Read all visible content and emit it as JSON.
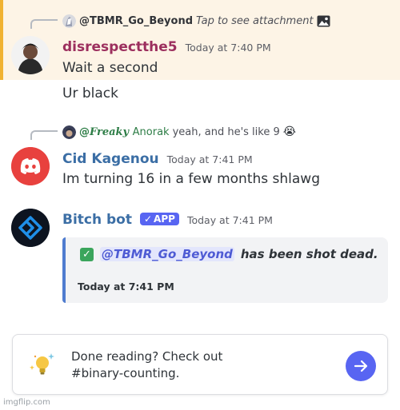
{
  "messages": [
    {
      "reply": {
        "name": "@TBMR_Go_Beyond",
        "text": "Tap to see attachment",
        "icon": "image-icon"
      },
      "author": "disrespectthe5",
      "author_color": "#9c2f5e",
      "timestamp": "Today at 7:40 PM",
      "lines": [
        "Wait a second",
        "Ur black"
      ]
    },
    {
      "reply": {
        "name_prefix": "@",
        "name_fancy": "Freaky",
        "name_rest": "Anorak",
        "text": "yeah, and he's like 9",
        "emoji": "😭"
      },
      "author": "Cid Kagenou",
      "author_color": "#3b6ea5",
      "timestamp": "Today at 7:41 PM",
      "lines": [
        "Im turning 16 in a few months shlawg"
      ]
    },
    {
      "author": "Bitch bot",
      "author_color": "#3b6ea5",
      "badge": "APP",
      "badge_check": "✓",
      "timestamp": "Today at 7:41 PM",
      "embed": {
        "mention": "@TBMR_Go_Beyond",
        "text": "has been shot dead.",
        "footer": "Today at 7:41 PM",
        "accent": "#4f7ccf"
      }
    }
  ],
  "notice": {
    "line1": "Done reading? Check out",
    "line2": "#binary-counting."
  },
  "watermark": "imgflip.com",
  "colors": {
    "highlight_bg": "#fdf4e6",
    "highlight_bar": "#f0b232",
    "blurple": "#5865f2",
    "discord_red": "#e8413e"
  }
}
